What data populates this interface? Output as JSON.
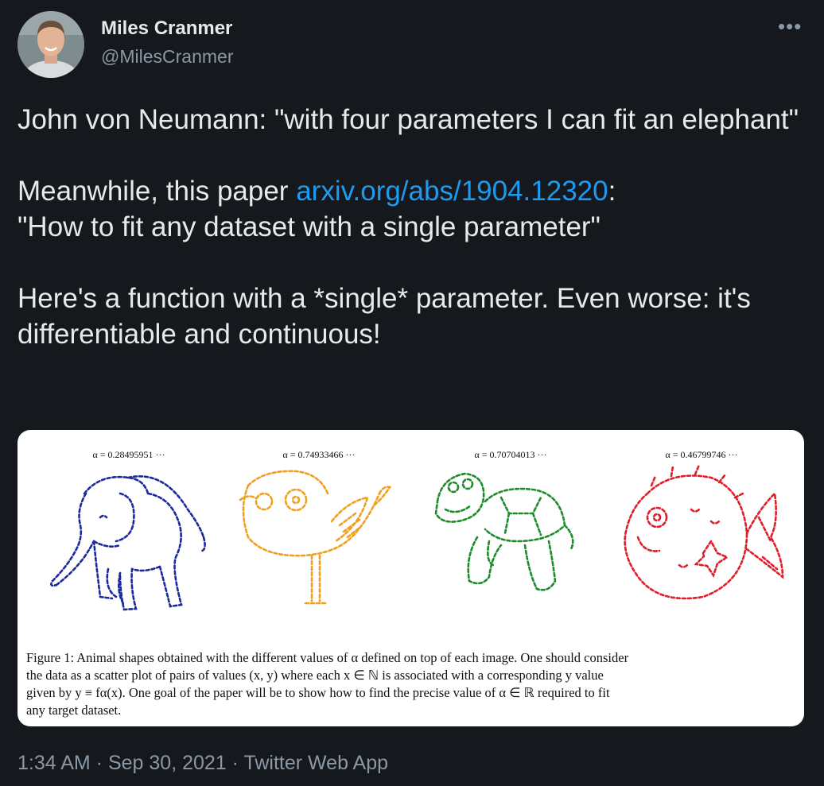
{
  "author": {
    "name": "Miles Cranmer",
    "handle": "@MilesCranmer"
  },
  "menu_icon": "more-horizontal-icon",
  "tweet": {
    "p1": "John von Neumann: \"with four parameters I can fit an elephant\"",
    "p2_before": "Meanwhile, this paper ",
    "p2_link": "arxiv.org/abs/1904.12320",
    "p2_after": ":",
    "p2_quote": "\"How to fit any dataset with a single parameter\"",
    "p3": "Here's a function with a *single* parameter. Even worse: it's differentiable and continuous!"
  },
  "figure": {
    "panels": [
      {
        "alpha": "α = 0.28495951 ···",
        "animal": "elephant",
        "color": "#1a2a9a"
      },
      {
        "alpha": "α = 0.74933466 ···",
        "animal": "bird",
        "color": "#f0a020"
      },
      {
        "alpha": "α = 0.70704013 ···",
        "animal": "turtle",
        "color": "#1c8c2a"
      },
      {
        "alpha": "α = 0.46799746 ···",
        "animal": "fish",
        "color": "#e01e2a"
      }
    ],
    "caption_lines": [
      "Figure 1: Animal shapes obtained with the different values of α defined on top of each image. One should consider",
      "the data as a scatter plot of pairs of values (x, y) where each x ∈ ℕ is associated with a corresponding y value",
      "given by y ≡ fα(x). One goal of the paper will be to show how to find the precise value of α ∈ ℝ required to fit",
      "any target dataset."
    ]
  },
  "footer": {
    "time": "1:34 AM",
    "sep1": " · ",
    "date": "Sep 30, 2021",
    "sep2": " · ",
    "app": "Twitter Web App"
  }
}
